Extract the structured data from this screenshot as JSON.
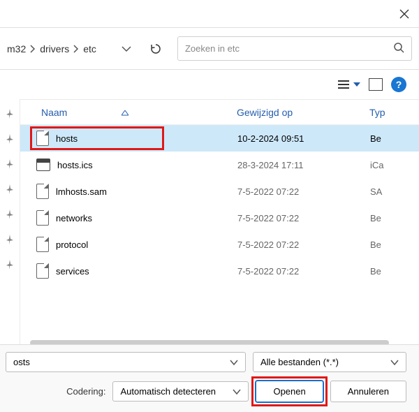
{
  "titlebar": {
    "close": "×"
  },
  "breadcrumb": {
    "items": [
      "m32",
      "drivers",
      "etc"
    ]
  },
  "search": {
    "placeholder": "Zoeken in etc"
  },
  "columns": {
    "name": "Naam",
    "modified": "Gewijzigd op",
    "type": "Typ"
  },
  "files": [
    {
      "name": "hosts",
      "modified": "10-2-2024 09:51",
      "type": "Be",
      "icon": "file",
      "selected": true
    },
    {
      "name": "hosts.ics",
      "modified": "28-3-2024 17:11",
      "type": "iCa",
      "icon": "cal"
    },
    {
      "name": "lmhosts.sam",
      "modified": "7-5-2022 07:22",
      "type": "SA",
      "icon": "file"
    },
    {
      "name": "networks",
      "modified": "7-5-2022 07:22",
      "type": "Be",
      "icon": "file"
    },
    {
      "name": "protocol",
      "modified": "7-5-2022 07:22",
      "type": "Be",
      "icon": "file"
    },
    {
      "name": "services",
      "modified": "7-5-2022 07:22",
      "type": "Be",
      "icon": "file"
    }
  ],
  "bottom": {
    "filename": "osts",
    "filter": "Alle bestanden  (*.*)",
    "encoding_label": "Codering:",
    "encoding": "Automatisch detecteren",
    "open": "Openen",
    "cancel": "Annuleren"
  },
  "help": "?"
}
